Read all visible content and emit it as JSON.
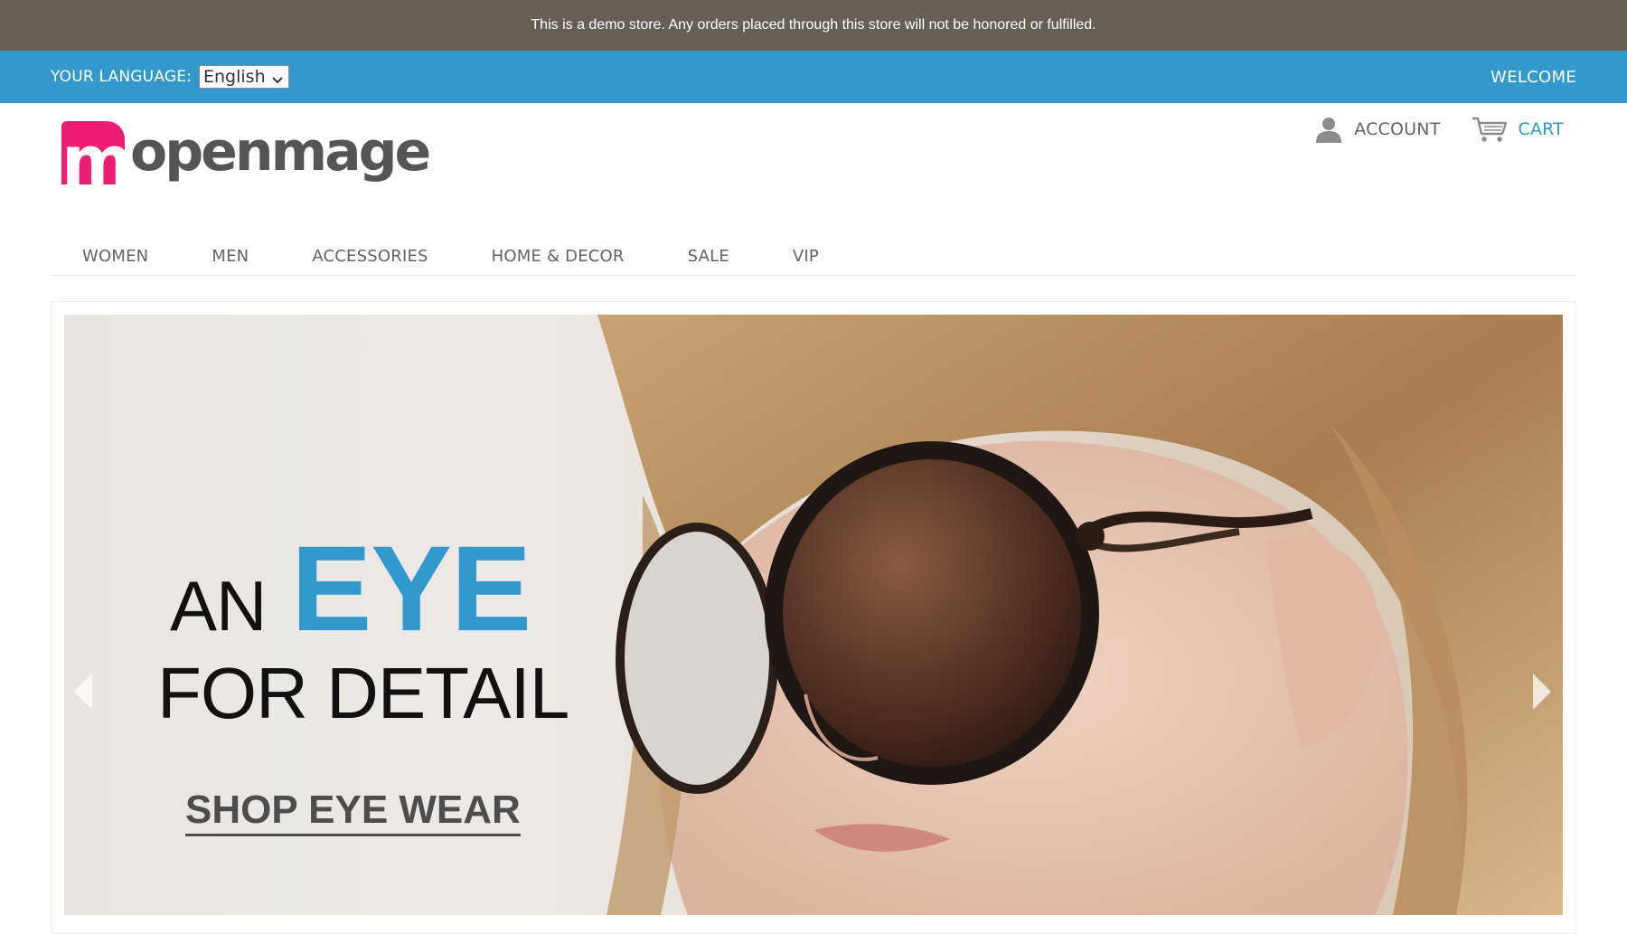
{
  "demo_notice": "This is a demo store. Any orders placed through this store will not be honored or fulfilled.",
  "language_bar": {
    "label": "YOUR LANGUAGE:",
    "selected_language": "English",
    "welcome": "WELCOME"
  },
  "logo": {
    "mark_letter": "m",
    "text": "openmage",
    "mark_color": "#ee1d74"
  },
  "header_links": {
    "account": "ACCOUNT",
    "cart": "CART",
    "account_icon": "person-icon",
    "cart_icon": "cart-icon"
  },
  "nav": {
    "items": [
      {
        "label": "WOMEN"
      },
      {
        "label": "MEN"
      },
      {
        "label": "ACCESSORIES"
      },
      {
        "label": "HOME & DECOR"
      },
      {
        "label": "SALE"
      },
      {
        "label": "VIP"
      }
    ]
  },
  "slider": {
    "headline_an": "AN",
    "headline_eye": "EYE",
    "headline_detail": "FOR DETAIL",
    "cta": "SHOP EYE WEAR",
    "prev_icon": "chevron-left-icon",
    "next_icon": "chevron-right-icon"
  },
  "colors": {
    "notice_bg": "#655f56",
    "accent_blue": "#3399cc",
    "text_gray": "#636363"
  }
}
